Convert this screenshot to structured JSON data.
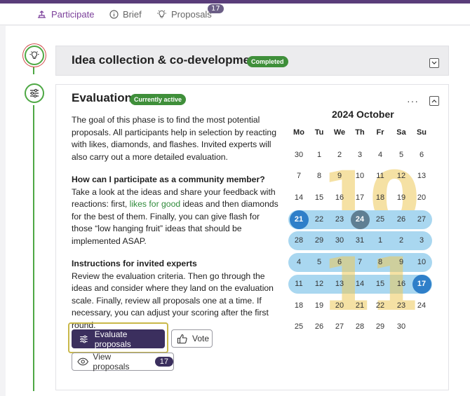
{
  "tabs": [
    {
      "label": "Participate"
    },
    {
      "label": "Brief"
    },
    {
      "label": "Proposals",
      "count": "17"
    }
  ],
  "phases": {
    "idea": {
      "title": "Idea collection & co-development",
      "status": "Completed"
    },
    "evaluation": {
      "title": "Evaluation",
      "status": "Currently active",
      "intro": "The goal of this phase is to find the most potential proposals. All participants help in selection by reacting with likes, diamonds, and flashes. Invited experts will also carry out a more detailed evaluation.",
      "community_heading": "How can I participate as a community member?",
      "community_text_1": "Take a look at the ideas and share your feedback with reactions: first, ",
      "community_link": "likes for good",
      "community_text_2": " ideas and then diamonds for the best of them. Finally, you can give flash for those “low hanging fruit” ideas that should be implemented ASAP.",
      "experts_heading": "Instructions for invited experts",
      "experts_text": "Review the evaluation criteria. Then go through the ideas and consider where they land on the evaluation scale. Finally, review all proposals one at a time. If necessary, you can adjust your scoring after the first round.",
      "more_label": "···"
    }
  },
  "calendar": {
    "title": "2024 October",
    "weekdays": [
      "Mo",
      "Tu",
      "We",
      "Th",
      "Fr",
      "Sa",
      "Su"
    ],
    "weeks": [
      [
        "30",
        "1",
        "2",
        "3",
        "4",
        "5",
        "6"
      ],
      [
        "7",
        "8",
        "9",
        "10",
        "11",
        "12",
        "13"
      ],
      [
        "14",
        "15",
        "16",
        "17",
        "18",
        "19",
        "20"
      ],
      [
        "21",
        "22",
        "23",
        "24",
        "25",
        "26",
        "27"
      ],
      [
        "28",
        "29",
        "30",
        "31",
        "1",
        "2",
        "3"
      ],
      [
        "4",
        "5",
        "6",
        "7",
        "8",
        "9",
        "10"
      ],
      [
        "11",
        "12",
        "13",
        "14",
        "15",
        "16",
        "17"
      ],
      [
        "18",
        "19",
        "20",
        "21",
        "22",
        "23",
        "24"
      ],
      [
        "25",
        "26",
        "27",
        "28",
        "29",
        "30",
        ""
      ]
    ],
    "watermark_top": "10",
    "watermark_bottom": "11",
    "range_color": "#a9d7f0",
    "start_color": "#2f7fc9",
    "today_color": "#5f7f93"
  },
  "actions": {
    "evaluate_label": "Evaluate proposals",
    "vote_label": "Vote",
    "view_label": "View proposals",
    "view_count": "17"
  }
}
